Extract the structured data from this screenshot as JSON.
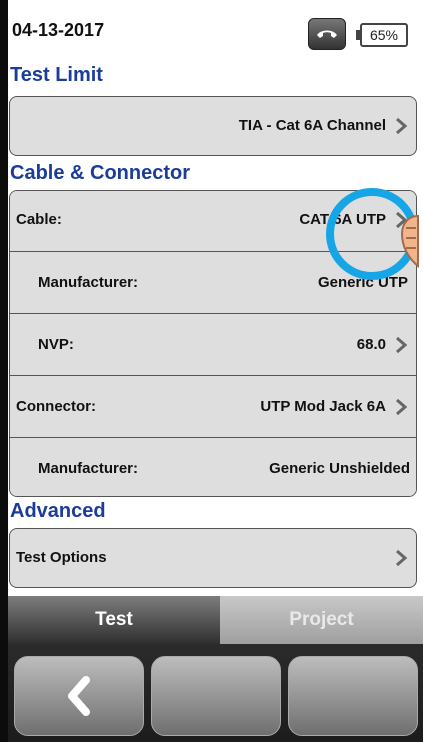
{
  "status": {
    "date": "04-13-2017",
    "battery": "65%",
    "icons": {
      "phone": "phone-icon"
    }
  },
  "sections": {
    "test_limit": {
      "title": "Test Limit",
      "value": "TIA - Cat 6A Channel"
    },
    "cable_connector": {
      "title": "Cable & Connector",
      "rows": [
        {
          "label": "Cable:",
          "value": "CAT 6A UTP"
        },
        {
          "label": "Manufacturer:",
          "value": "Generic UTP"
        },
        {
          "label": "NVP:",
          "value": "68.0"
        },
        {
          "label": "Connector:",
          "value": "UTP Mod Jack 6A"
        },
        {
          "label": "Manufacturer:",
          "value": "Generic Unshielded"
        }
      ]
    },
    "advanced": {
      "title": "Advanced",
      "rows": [
        {
          "label": "Test Options",
          "value": ""
        }
      ]
    }
  },
  "tabs": {
    "test": "Test",
    "project": "Project"
  },
  "softkeys": {
    "back_icon": "back-chevron-icon"
  },
  "colors": {
    "section_title": "#1b3c9a",
    "annotation": "#16a6e6"
  }
}
